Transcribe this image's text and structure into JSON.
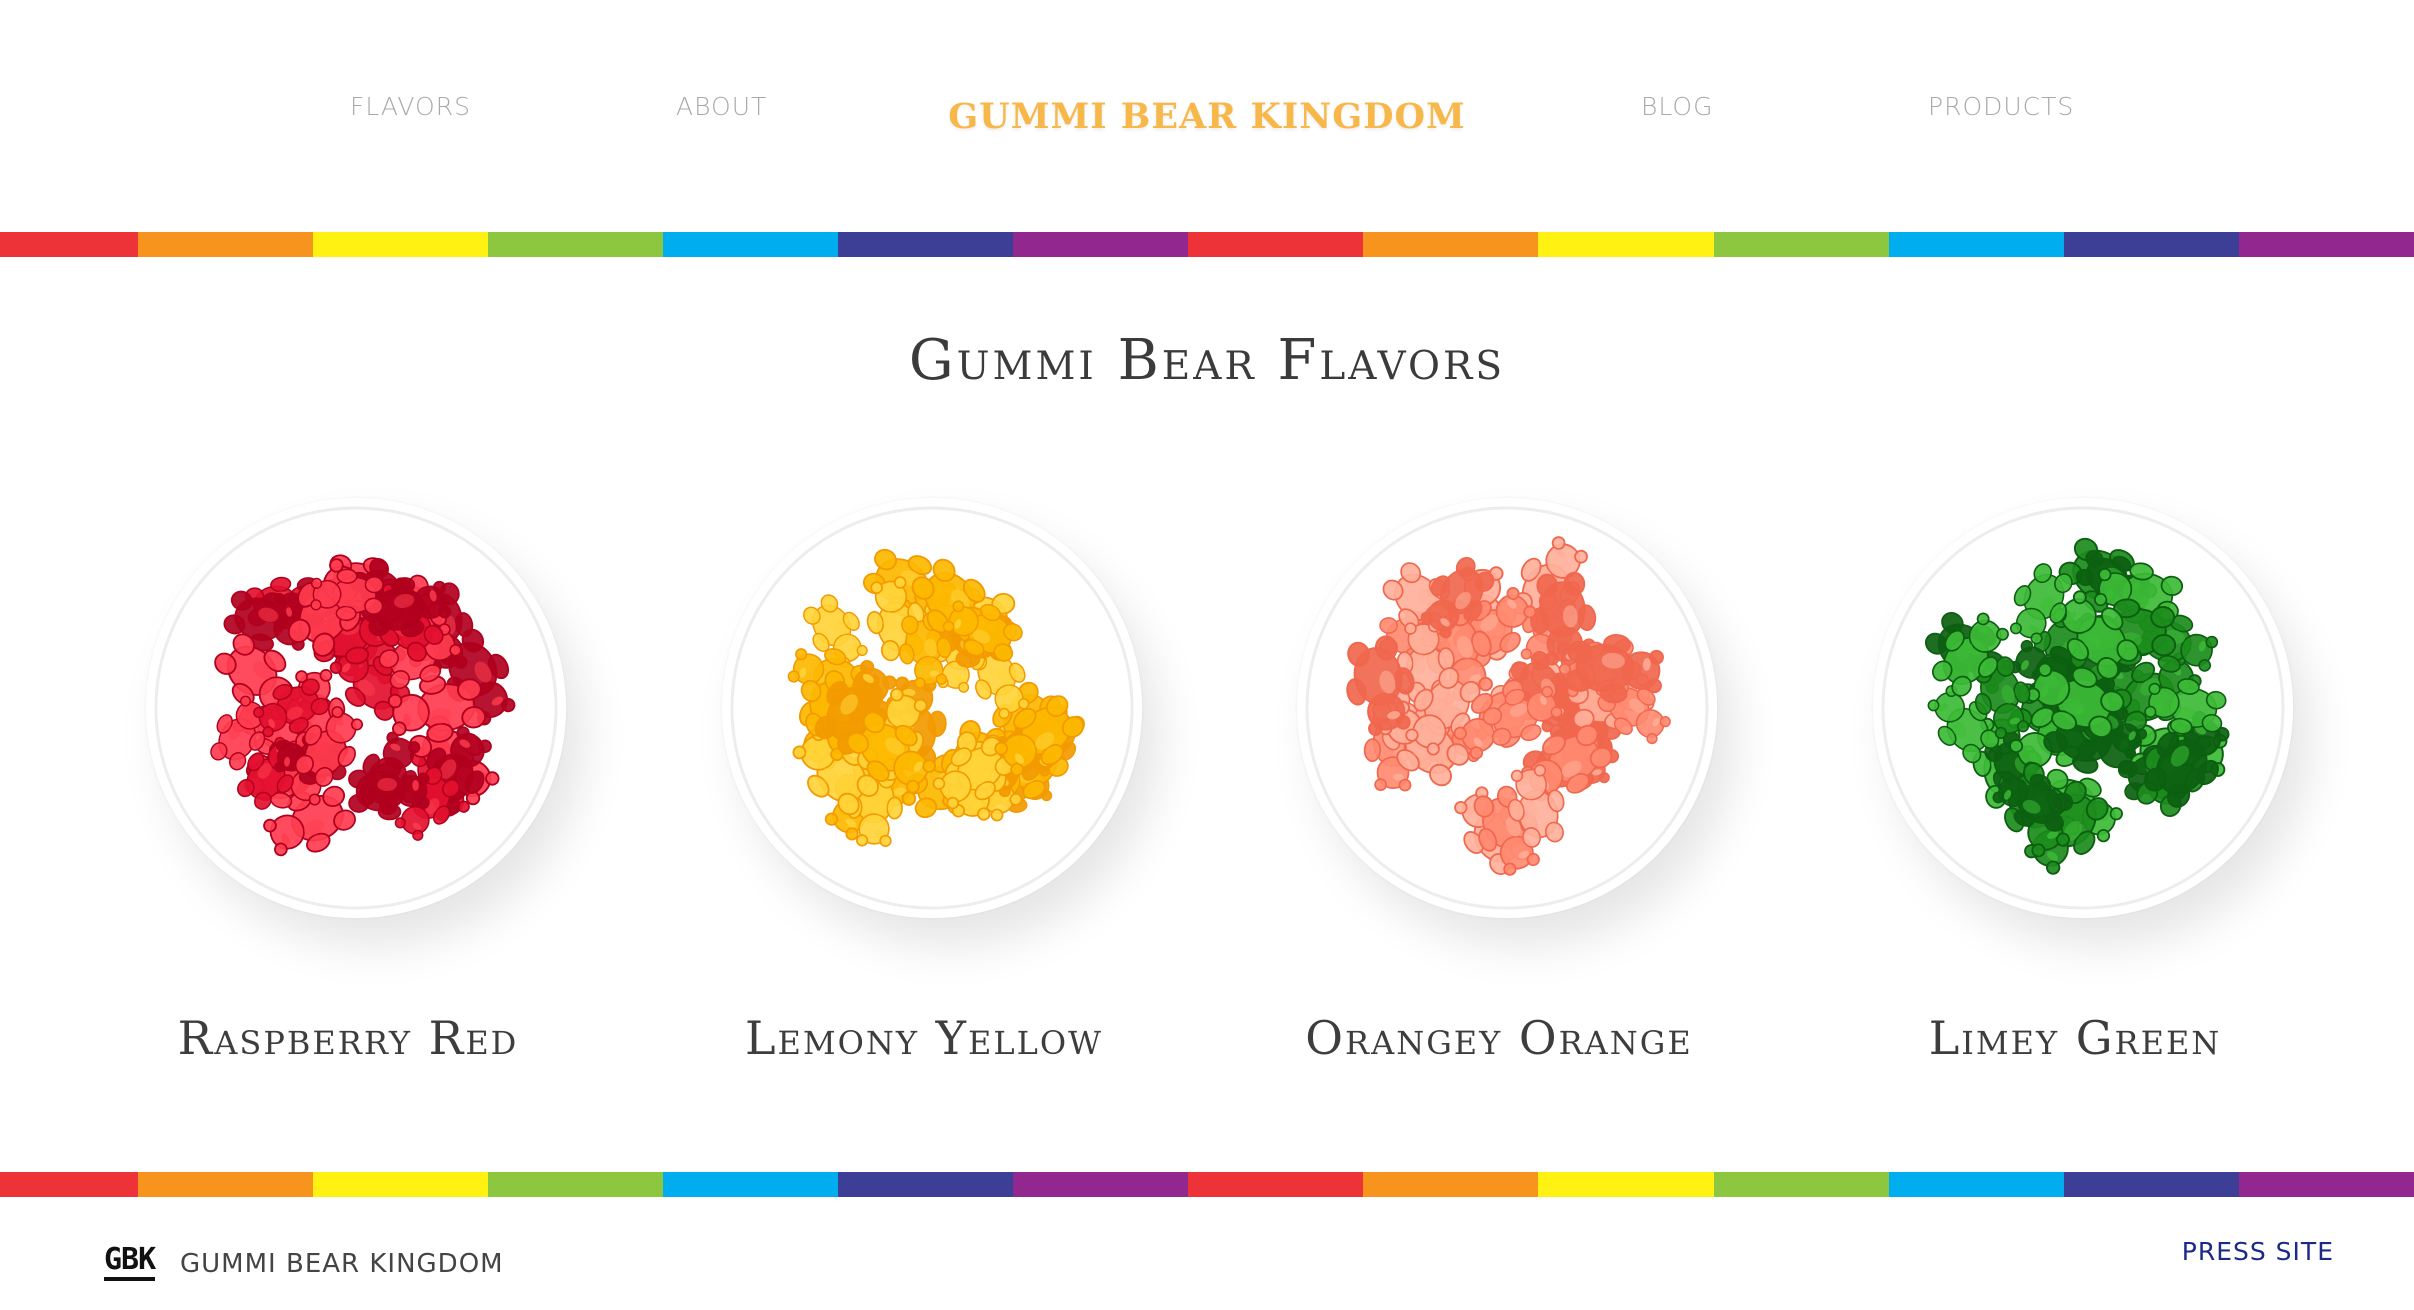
{
  "nav": {
    "links": [
      "FLAVORS",
      "ABOUT",
      "BLOG",
      "PRODUCTS"
    ],
    "brand": "GUMMI BEAR KINGDOM"
  },
  "stripe_colors": [
    "#ee3338",
    "#f7941d",
    "#fff212",
    "#8dc63f",
    "#00aeef",
    "#3c3f95",
    "#92278f"
  ],
  "main": {
    "title": "Gummi Bear Flavors",
    "flavors": [
      {
        "name": "Raspberry Red",
        "color": "#e3102f",
        "light": "#ff3c4f",
        "dark": "#b0001e"
      },
      {
        "name": "Lemony Yellow",
        "color": "#fdb800",
        "light": "#ffd43a",
        "dark": "#f29a00"
      },
      {
        "name": "Orangey Orange",
        "color": "#ff8a70",
        "light": "#ffb09a",
        "dark": "#f0674e"
      },
      {
        "name": "Limey Green",
        "color": "#1c8c1c",
        "light": "#3dbb36",
        "dark": "#0c5f10"
      }
    ]
  },
  "footer": {
    "logo": "GBK",
    "name": "GUMMI BEAR KINGDOM",
    "press_link": "PRESS SITE"
  }
}
